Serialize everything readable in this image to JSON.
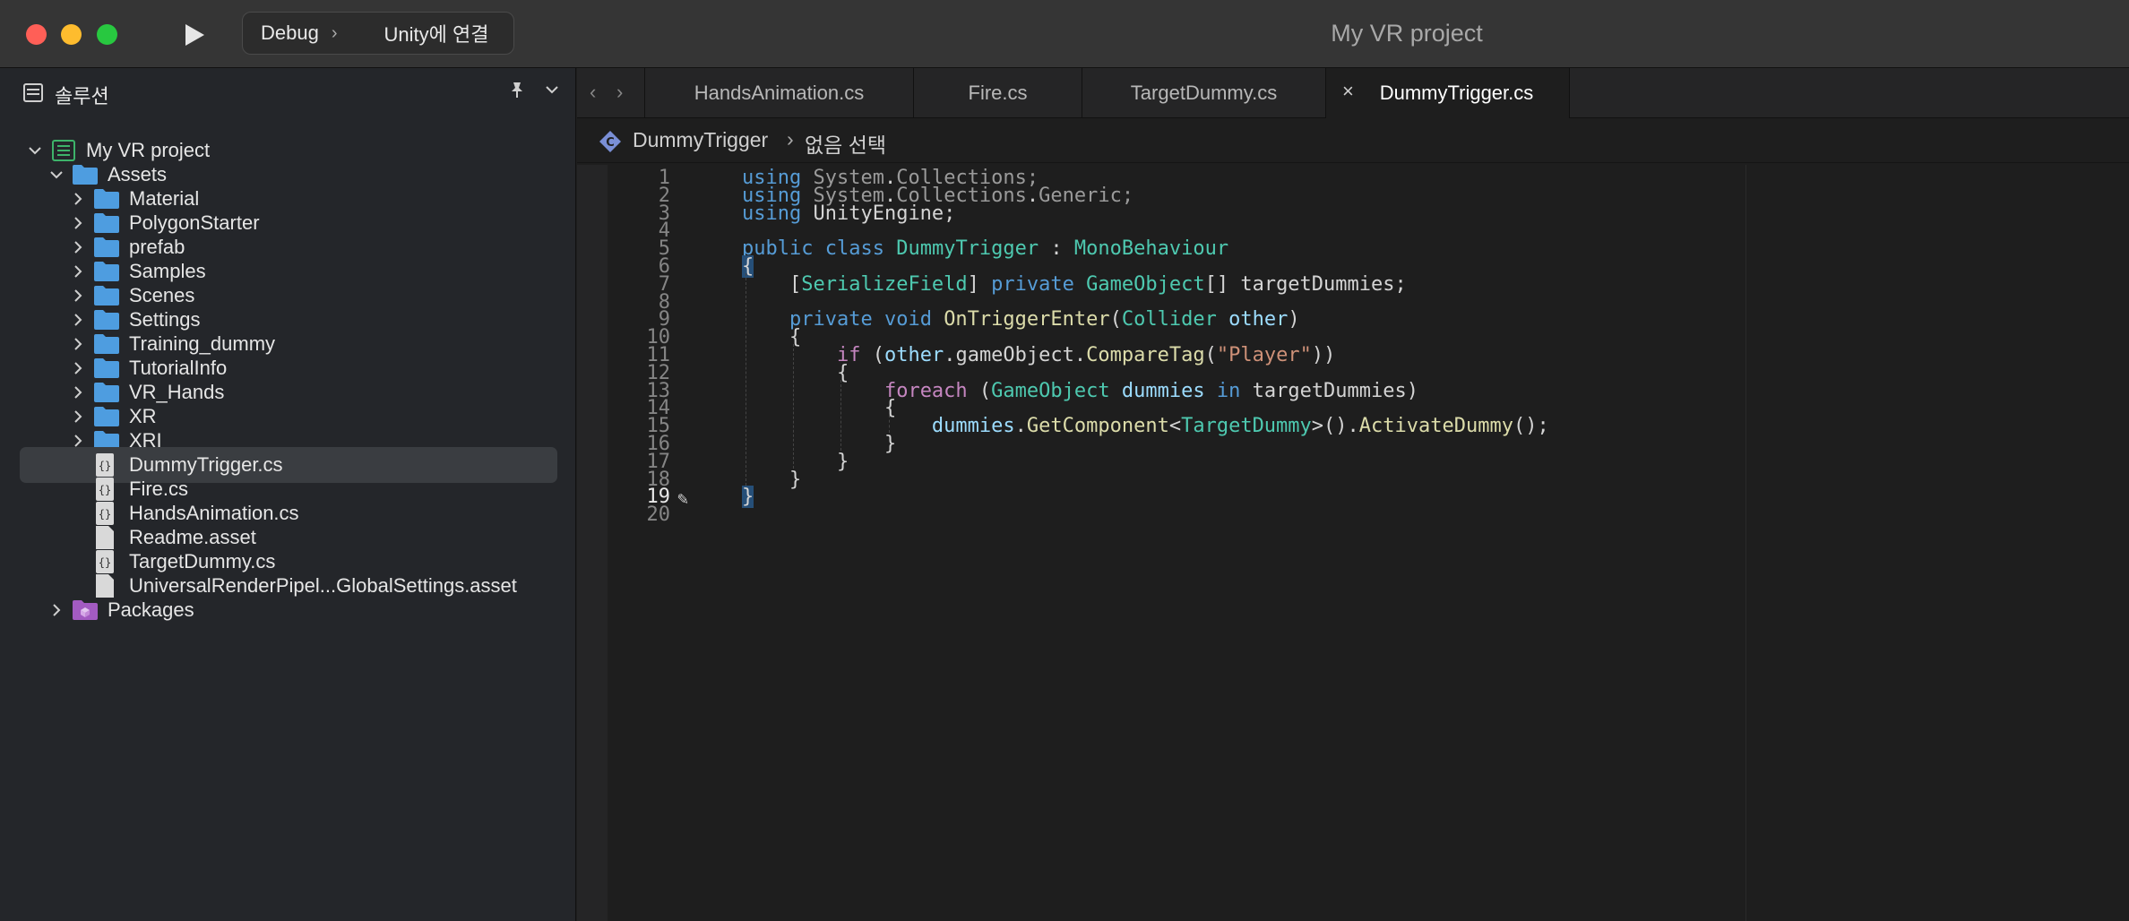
{
  "window": {
    "title": "My VR project"
  },
  "toolbar": {
    "configuration": "Debug",
    "separator": "›",
    "run_target": "Unity에 연결"
  },
  "sidebar": {
    "title": "솔루션",
    "tree": [
      {
        "label": "My VR project",
        "kind": "solution",
        "expanded": true
      },
      {
        "label": "Assets",
        "kind": "folder",
        "expanded": true
      },
      {
        "label": "Material",
        "kind": "folder"
      },
      {
        "label": "PolygonStarter",
        "kind": "folder"
      },
      {
        "label": "prefab",
        "kind": "folder"
      },
      {
        "label": "Samples",
        "kind": "folder"
      },
      {
        "label": "Scenes",
        "kind": "folder"
      },
      {
        "label": "Settings",
        "kind": "folder"
      },
      {
        "label": "Training_dummy",
        "kind": "folder"
      },
      {
        "label": "TutorialInfo",
        "kind": "folder"
      },
      {
        "label": "VR_Hands",
        "kind": "folder"
      },
      {
        "label": "XR",
        "kind": "folder"
      },
      {
        "label": "XRI",
        "kind": "folder"
      },
      {
        "label": "DummyTrigger.cs",
        "kind": "cs-file",
        "selected": true
      },
      {
        "label": "Fire.cs",
        "kind": "cs-file"
      },
      {
        "label": "HandsAnimation.cs",
        "kind": "cs-file"
      },
      {
        "label": "Readme.asset",
        "kind": "asset-file"
      },
      {
        "label": "TargetDummy.cs",
        "kind": "cs-file"
      },
      {
        "label": "UniversalRenderPipel...GlobalSettings.asset",
        "kind": "asset-file"
      },
      {
        "label": "Packages",
        "kind": "packages"
      }
    ]
  },
  "tabs": [
    {
      "label": "HandsAnimation.cs"
    },
    {
      "label": "Fire.cs"
    },
    {
      "label": "TargetDummy.cs"
    },
    {
      "label": "DummyTrigger.cs",
      "active": true,
      "close": "×"
    }
  ],
  "breadcrumb": {
    "class_name": "DummyTrigger",
    "separator": "›",
    "selection": "없음 선택"
  },
  "editor": {
    "current_line": 19,
    "line_numbers": [
      "1",
      "2",
      "3",
      "4",
      "5",
      "6",
      "7",
      "8",
      "9",
      "10",
      "11",
      "12",
      "13",
      "14",
      "15",
      "16",
      "17",
      "18",
      "19",
      "20"
    ],
    "lines": [
      "using System.Collections;",
      "using System.Collections.Generic;",
      "using UnityEngine;",
      "",
      "public class DummyTrigger : MonoBehaviour",
      "{",
      "    [SerializeField] private GameObject[] targetDummies;",
      "",
      "    private void OnTriggerEnter(Collider other)",
      "    {",
      "        if (other.gameObject.CompareTag(\"Player\"))",
      "        {",
      "            foreach (GameObject dummies in targetDummies)",
      "            {",
      "                dummies.GetComponent<TargetDummy>().ActivateDummy();",
      "            }",
      "        }",
      "    }",
      "}",
      ""
    ]
  },
  "colors": {
    "keyword": "#569cd6",
    "control": "#c586c0",
    "type": "#4ec9b0",
    "function": "#dcdcaa",
    "variable": "#9cdcfe",
    "string": "#ce9178"
  }
}
